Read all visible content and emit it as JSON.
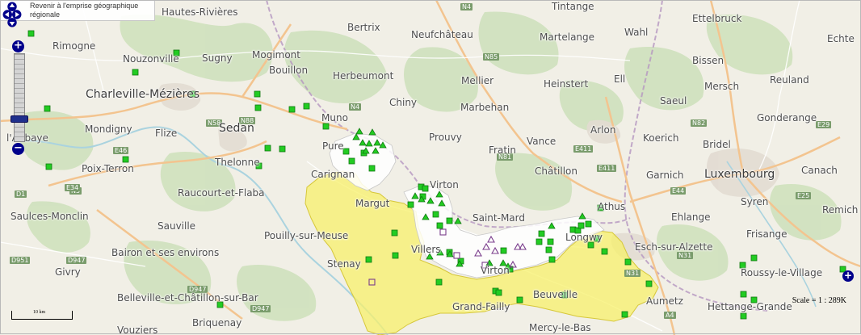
{
  "controls": {
    "back_label_line1": "Revenir à l'emprise géographique",
    "back_label_line2": "régionale",
    "zoom_in": "+",
    "zoom_out": "−",
    "scale_text": "Scale = 1 : 289K",
    "scalebar_label": "10 km"
  },
  "colors": {
    "region_fill": "#f7f06b",
    "marker_green": "#22cc22",
    "marker_purple": "#7a3d8c",
    "control_blue": "#00008b"
  },
  "places": [
    {
      "name": "Hautes-Rivières",
      "big": false
    },
    {
      "name": "Bertrix",
      "big": false
    },
    {
      "name": "Neufchâteau",
      "big": false
    },
    {
      "name": "Tintange",
      "big": false
    },
    {
      "name": "Ettelbruck",
      "big": false
    },
    {
      "name": "Echte",
      "big": false
    },
    {
      "name": "Rimogne",
      "big": false
    },
    {
      "name": "Mogimont",
      "big": false
    },
    {
      "name": "Martelange",
      "big": false
    },
    {
      "name": "Wahl",
      "big": false
    },
    {
      "name": "Nouzonville",
      "big": false
    },
    {
      "name": "Sugny",
      "big": false
    },
    {
      "name": "Bouillon",
      "big": false
    },
    {
      "name": "Herbeumont",
      "big": false
    },
    {
      "name": "Bissen",
      "big": false
    },
    {
      "name": "Mellier",
      "big": false
    },
    {
      "name": "Heinstert",
      "big": false
    },
    {
      "name": "Ell",
      "big": false
    },
    {
      "name": "Mersch",
      "big": false
    },
    {
      "name": "Reuland",
      "big": false
    },
    {
      "name": "Charleville-Mézières",
      "big": true
    },
    {
      "name": "Chiny",
      "big": false
    },
    {
      "name": "Marbehan",
      "big": false
    },
    {
      "name": "Saeul",
      "big": false
    },
    {
      "name": "Muno",
      "big": false
    },
    {
      "name": "Gonderange",
      "big": false
    },
    {
      "name": "Mondigny",
      "big": false
    },
    {
      "name": "Flize",
      "big": false
    },
    {
      "name": "Sedan",
      "big": true
    },
    {
      "name": "Prouvy",
      "big": false
    },
    {
      "name": "Vance",
      "big": false
    },
    {
      "name": "Arlon",
      "big": false
    },
    {
      "name": "Koerich",
      "big": false
    },
    {
      "name": "Bridel",
      "big": false
    },
    {
      "name": "l'Abbaye",
      "big": false
    },
    {
      "name": "Pure",
      "big": false
    },
    {
      "name": "Fratin",
      "big": false
    },
    {
      "name": "Thelonne",
      "big": false
    },
    {
      "name": "Poix-Terron",
      "big": false
    },
    {
      "name": "Châtillon",
      "big": false
    },
    {
      "name": "Carignan",
      "big": false
    },
    {
      "name": "Garnich",
      "big": false
    },
    {
      "name": "Luxembourg",
      "big": true
    },
    {
      "name": "Canach",
      "big": false
    },
    {
      "name": "Virton",
      "big": false
    },
    {
      "name": "Raucourt-et-Flaba",
      "big": false
    },
    {
      "name": "Margut",
      "big": false
    },
    {
      "name": "Athus",
      "big": false
    },
    {
      "name": "Syren",
      "big": false
    },
    {
      "name": "Saulces-Monclin",
      "big": false
    },
    {
      "name": "Saint-Mard",
      "big": false
    },
    {
      "name": "Ehlange",
      "big": false
    },
    {
      "name": "Remich",
      "big": false
    },
    {
      "name": "Sauville",
      "big": false
    },
    {
      "name": "Pouilly-sur-Meuse",
      "big": false
    },
    {
      "name": "Longwy",
      "big": false
    },
    {
      "name": "Frisange",
      "big": false
    },
    {
      "name": "Esch-sur-Alzette",
      "big": false
    },
    {
      "name": "Bairon et ses environs",
      "big": false
    },
    {
      "name": "Villers",
      "big": false
    },
    {
      "name": "Stenay",
      "big": false
    },
    {
      "name": "Roussy-le-Village",
      "big": false
    },
    {
      "name": "Givry",
      "big": false
    },
    {
      "name": "Virton",
      "big": false
    },
    {
      "name": "Beuveille",
      "big": false
    },
    {
      "name": "Belleville-et-Châtillon-sur-Bar",
      "big": false
    },
    {
      "name": "Aumetz",
      "big": false
    },
    {
      "name": "Grand-Failly",
      "big": false
    },
    {
      "name": "Hettange-Grande",
      "big": false
    },
    {
      "name": "Briquenay",
      "big": false
    },
    {
      "name": "Vouziers",
      "big": false
    },
    {
      "name": "Mercy-le-Bas",
      "big": false
    }
  ],
  "roads": [
    "N4",
    "N85",
    "N88",
    "N4",
    "N81",
    "N82",
    "E411",
    "E25",
    "E44",
    "E29",
    "E411",
    "N31",
    "N58",
    "D1",
    "N5",
    "E46",
    "D947",
    "D947",
    "E34",
    "D951",
    "D947",
    "N31",
    "A4"
  ]
}
